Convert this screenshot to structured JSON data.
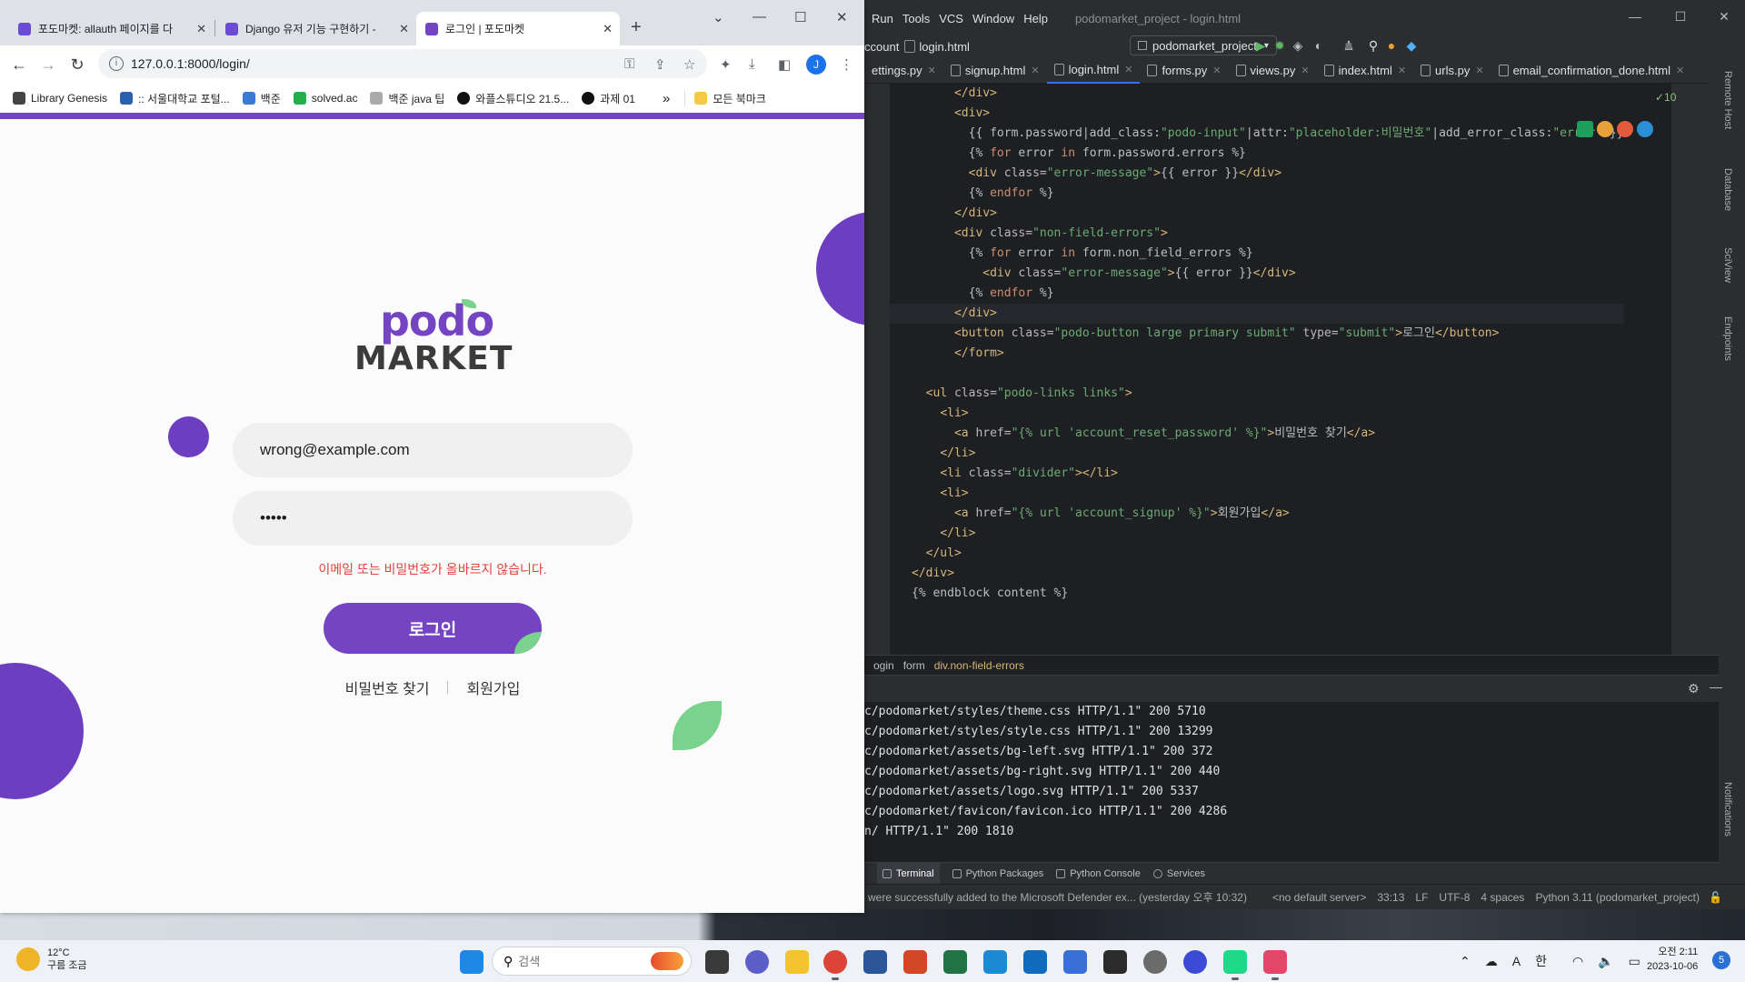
{
  "chrome": {
    "tabs": [
      {
        "title": "포도마켓: allauth 페이지를 다",
        "favicon_color": "#6b4bd6"
      },
      {
        "title": "Django 유저 기능 구현하기 -",
        "favicon_color": "#6b4bd6"
      },
      {
        "title": "로그인 | 포도마켓",
        "favicon_color": "#7444c3",
        "active": true
      }
    ],
    "new_tab_label": "+",
    "url": "127.0.0.1:8000/login/",
    "profile_initial": "J",
    "bookmarks": [
      {
        "label": "Library Genesis",
        "icon_color": "#444"
      },
      {
        "label": ":: 서울대학교 포털...",
        "icon_color": "#2b5fb0"
      },
      {
        "label": "백준",
        "icon_color": "#3b7bd6"
      },
      {
        "label": "solved.ac",
        "icon_color": "#21b04b"
      },
      {
        "label": "백준 java 팁",
        "icon_color": "#aaaaaa"
      },
      {
        "label": "와플스튜디오 21.5...",
        "icon_color": "#111111"
      },
      {
        "label": "과제 01",
        "icon_color": "#111111"
      }
    ],
    "bookmarks_overflow": "»",
    "all_bookmarks_label": "모든 북마크"
  },
  "login_page": {
    "logo_top": "podo",
    "logo_bottom": "MARKET",
    "email_value": "wrong@example.com",
    "password_value": "•••••",
    "error_message": "이메일 또는 비밀번호가 올바르지 않습니다.",
    "login_button": "로그인",
    "link_reset": "비밀번호 찾기",
    "link_signup": "회원가입",
    "brand_color": "#7444c3",
    "leaf_color": "#7ad38d"
  },
  "ide": {
    "menu": [
      "Run",
      "Tools",
      "VCS",
      "Window",
      "Help"
    ],
    "window_title": "podomarket_project - login.html",
    "breadcrumb_left": "ccount",
    "breadcrumb_file": "login.html",
    "run_config": "podomarket_project",
    "tabs": [
      {
        "label": "ettings.py"
      },
      {
        "label": "signup.html"
      },
      {
        "label": "login.html",
        "active": true
      },
      {
        "label": "forms.py"
      },
      {
        "label": "views.py"
      },
      {
        "label": "index.html"
      },
      {
        "label": "urls.py"
      },
      {
        "label": "email_confirmation_done.html"
      }
    ],
    "inspection_count": "✓10",
    "code_lines": [
      {
        "indent": "      ",
        "parts": [
          {
            "c": "tg",
            "t": "</div>"
          }
        ]
      },
      {
        "indent": "      ",
        "parts": [
          {
            "c": "tg",
            "t": "<div>"
          }
        ]
      },
      {
        "indent": "        ",
        "parts": [
          {
            "c": "tx",
            "t": "{{ form.password|add_class:"
          },
          {
            "c": "sv",
            "t": "\"podo-input\""
          },
          {
            "c": "tx",
            "t": "|attr:"
          },
          {
            "c": "sv",
            "t": "\"placeholder:비밀번호\""
          },
          {
            "c": "tx",
            "t": "|add_error_class:"
          },
          {
            "c": "sv",
            "t": "\"error\""
          },
          {
            "c": "tx",
            "t": " }}"
          }
        ]
      },
      {
        "indent": "        ",
        "parts": [
          {
            "c": "tx",
            "t": "{% "
          },
          {
            "c": "kw",
            "t": "for"
          },
          {
            "c": "tx",
            "t": " error "
          },
          {
            "c": "kw",
            "t": "in"
          },
          {
            "c": "tx",
            "t": " form.password.errors %}"
          }
        ]
      },
      {
        "indent": "        ",
        "parts": [
          {
            "c": "tg",
            "t": "<div "
          },
          {
            "c": "at",
            "t": "class="
          },
          {
            "c": "sv",
            "t": "\"error-message\""
          },
          {
            "c": "tg",
            "t": ">"
          },
          {
            "c": "tx",
            "t": "{{ error }}"
          },
          {
            "c": "tg",
            "t": "</div>"
          }
        ]
      },
      {
        "indent": "        ",
        "parts": [
          {
            "c": "tx",
            "t": "{% "
          },
          {
            "c": "kw",
            "t": "endfor"
          },
          {
            "c": "tx",
            "t": " %}"
          }
        ]
      },
      {
        "indent": "      ",
        "parts": [
          {
            "c": "tg",
            "t": "</div>"
          }
        ]
      },
      {
        "indent": "      ",
        "parts": [
          {
            "c": "tg",
            "t": "<div "
          },
          {
            "c": "at",
            "t": "class="
          },
          {
            "c": "sv",
            "t": "\"non-field-errors\""
          },
          {
            "c": "tg",
            "t": ">"
          }
        ]
      },
      {
        "indent": "        ",
        "parts": [
          {
            "c": "tx",
            "t": "{% "
          },
          {
            "c": "kw",
            "t": "for"
          },
          {
            "c": "tx",
            "t": " error "
          },
          {
            "c": "kw",
            "t": "in"
          },
          {
            "c": "tx",
            "t": " form.non_field_errors %}"
          }
        ]
      },
      {
        "indent": "          ",
        "parts": [
          {
            "c": "tg",
            "t": "<div "
          },
          {
            "c": "at",
            "t": "class="
          },
          {
            "c": "sv",
            "t": "\"error-message\""
          },
          {
            "c": "tg",
            "t": ">"
          },
          {
            "c": "tx",
            "t": "{{ error }}"
          },
          {
            "c": "tg",
            "t": "</div>"
          }
        ]
      },
      {
        "indent": "        ",
        "parts": [
          {
            "c": "tx",
            "t": "{% "
          },
          {
            "c": "kw",
            "t": "endfor"
          },
          {
            "c": "tx",
            "t": " %}"
          }
        ]
      },
      {
        "indent": "      ",
        "parts": [
          {
            "c": "tg",
            "t": "</div>"
          }
        ],
        "current": true
      },
      {
        "indent": "      ",
        "parts": [
          {
            "c": "tg",
            "t": "<button "
          },
          {
            "c": "at",
            "t": "class="
          },
          {
            "c": "sv",
            "t": "\"podo-button large primary submit\""
          },
          {
            "c": "at",
            "t": " type="
          },
          {
            "c": "sv",
            "t": "\"submit\""
          },
          {
            "c": "tg",
            "t": ">"
          },
          {
            "c": "tx",
            "t": "로그인"
          },
          {
            "c": "tg",
            "t": "</button>"
          }
        ]
      },
      {
        "indent": "      ",
        "parts": [
          {
            "c": "tg",
            "t": "</form>"
          }
        ]
      },
      {
        "indent": "",
        "parts": []
      },
      {
        "indent": "  ",
        "parts": [
          {
            "c": "tg",
            "t": "<ul "
          },
          {
            "c": "at",
            "t": "class="
          },
          {
            "c": "sv",
            "t": "\"podo-links links\""
          },
          {
            "c": "tg",
            "t": ">"
          }
        ]
      },
      {
        "indent": "    ",
        "parts": [
          {
            "c": "tg",
            "t": "<li>"
          }
        ]
      },
      {
        "indent": "      ",
        "parts": [
          {
            "c": "tg",
            "t": "<a "
          },
          {
            "c": "at",
            "t": "href="
          },
          {
            "c": "sv",
            "t": "\"{% url 'account_reset_password' %}\""
          },
          {
            "c": "tg",
            "t": ">"
          },
          {
            "c": "tx",
            "t": "비밀번호 찾기"
          },
          {
            "c": "tg",
            "t": "</a>"
          }
        ]
      },
      {
        "indent": "    ",
        "parts": [
          {
            "c": "tg",
            "t": "</li>"
          }
        ]
      },
      {
        "indent": "    ",
        "parts": [
          {
            "c": "tg",
            "t": "<li "
          },
          {
            "c": "at",
            "t": "class="
          },
          {
            "c": "sv",
            "t": "\"divider\""
          },
          {
            "c": "tg",
            "t": "></li>"
          }
        ]
      },
      {
        "indent": "    ",
        "parts": [
          {
            "c": "tg",
            "t": "<li>"
          }
        ]
      },
      {
        "indent": "      ",
        "parts": [
          {
            "c": "tg",
            "t": "<a "
          },
          {
            "c": "at",
            "t": "href="
          },
          {
            "c": "sv",
            "t": "\"{% url 'account_signup' %}\""
          },
          {
            "c": "tg",
            "t": ">"
          },
          {
            "c": "tx",
            "t": "회원가입"
          },
          {
            "c": "tg",
            "t": "</a>"
          }
        ]
      },
      {
        "indent": "    ",
        "parts": [
          {
            "c": "tg",
            "t": "</li>"
          }
        ]
      },
      {
        "indent": "  ",
        "parts": [
          {
            "c": "tg",
            "t": "</ul>"
          }
        ]
      },
      {
        "indent": "",
        "parts": [
          {
            "c": "tg",
            "t": "</div>"
          }
        ]
      },
      {
        "indent": "",
        "parts": [
          {
            "c": "tx",
            "t": "{% endblock content %}"
          }
        ]
      }
    ],
    "editor_breadcrumb": [
      "ogin",
      "form",
      "div.non-field-errors"
    ],
    "terminal_lines": [
      "c/podomarket/styles/theme.css HTTP/1.1\" 200 5710",
      "c/podomarket/styles/style.css HTTP/1.1\" 200 13299",
      "c/podomarket/assets/bg-left.svg HTTP/1.1\" 200 372",
      "c/podomarket/assets/bg-right.svg HTTP/1.1\" 200 440",
      "c/podomarket/assets/logo.svg HTTP/1.1\" 200 5337",
      "c/podomarket/favicon/favicon.ico HTTP/1.1\" 200 4286",
      "n/ HTTP/1.1\" 200 1810"
    ],
    "tool_tabs": [
      "Terminal",
      "Python Packages",
      "Python Console",
      "Services"
    ],
    "status": {
      "message": "were successfully added to the Microsoft Defender ex... (yesterday 오후 10:32)",
      "server": "<no default server>",
      "position": "33:13",
      "line_sep": "LF",
      "encoding": "UTF-8",
      "indent": "4 spaces",
      "interpreter": "Python 3.11 (podomarket_project)"
    },
    "side_labels": [
      "Remote Host",
      "Database",
      "SciView",
      "Endpoints",
      "Notifications"
    ]
  },
  "taskbar": {
    "weather_temp": "12°C",
    "weather_desc": "구름 조금",
    "search_placeholder": "검색",
    "apps": [
      {
        "name": "windows-start-icon",
        "color": "#1e88e5"
      },
      {
        "name": "task-view-icon",
        "color": "#3a3a3a"
      },
      {
        "name": "chat-icon",
        "color": "#5b5fc7"
      },
      {
        "name": "file-explorer-icon",
        "color": "#f4c430"
      },
      {
        "name": "chrome-icon",
        "color": "#db4437",
        "running": true
      },
      {
        "name": "word-icon",
        "color": "#2b579a"
      },
      {
        "name": "powerpoint-icon",
        "color": "#d24726"
      },
      {
        "name": "excel-icon",
        "color": "#217346"
      },
      {
        "name": "app-blue-icon",
        "color": "#1c8ad4"
      },
      {
        "name": "mail-icon",
        "color": "#0f6cbd"
      },
      {
        "name": "notepad-icon",
        "color": "#3a6fd8"
      },
      {
        "name": "sticky-notes-icon",
        "color": "#2b2b2b"
      },
      {
        "name": "settings-icon",
        "color": "#6b6b6b"
      },
      {
        "name": "dev-app-icon",
        "color": "#3b4bd6"
      },
      {
        "name": "pycharm-icon",
        "color": "#21d789",
        "running": true
      },
      {
        "name": "snipping-tool-icon",
        "color": "#e4466b",
        "running": true
      }
    ],
    "tray_lang": "한",
    "tray_font": "A",
    "time": "오전 2:11",
    "date": "2023-10-06",
    "notification_count": "5"
  }
}
